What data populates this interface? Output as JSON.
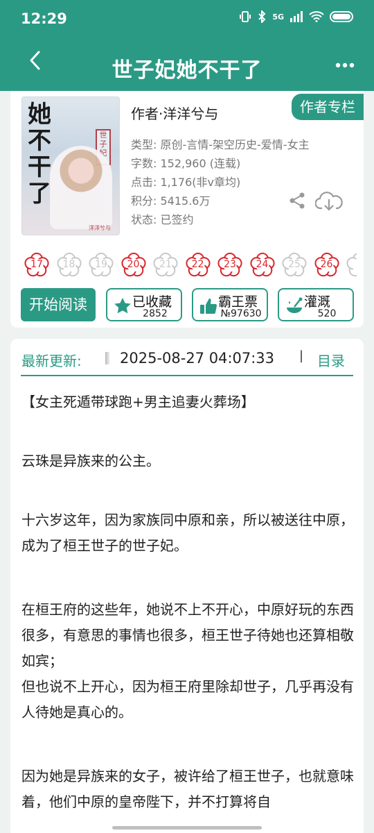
{
  "status_bar": {
    "time": "12:29",
    "network": "5G"
  },
  "nav": {
    "title": "世子妃她不干了"
  },
  "book": {
    "cover": {
      "title_art": "她不干了",
      "tag": "世子妃",
      "author_mark": "洋洋兮与"
    },
    "author": "作者·洋洋兮与",
    "author_column_button": "作者专栏",
    "type": "类型: 原创-言情-架空历史-爱情-女主",
    "words": "字数: 152,960 (连载)",
    "clicks": "点击: 1,176(非v章均)",
    "score": "积分: 5415.6万",
    "status": "状态: 已签约"
  },
  "flowers": [
    {
      "n": "17",
      "active": true
    },
    {
      "n": "18",
      "active": false
    },
    {
      "n": "19",
      "active": false
    },
    {
      "n": "20",
      "active": true
    },
    {
      "n": "21",
      "active": false
    },
    {
      "n": "22",
      "active": true
    },
    {
      "n": "23",
      "active": true
    },
    {
      "n": "24",
      "active": true
    },
    {
      "n": "25",
      "active": false
    },
    {
      "n": "26",
      "active": true
    },
    {
      "n": "",
      "active": false
    }
  ],
  "actions": {
    "start_reading": "开始阅读",
    "favorite": {
      "label": "已收藏",
      "count": "2852"
    },
    "bawang": {
      "label": "霸王票",
      "count": "№97630"
    },
    "guangai": {
      "label": "灌溉",
      "count": "520"
    }
  },
  "colors": {
    "primary": "#2b9a85",
    "flower_red": "#d9252b",
    "flower_grey": "#c8c8c8"
  },
  "update": {
    "label": "最新更新:",
    "date": "2025-08-27 04:07:33",
    "separator": "|",
    "toc": "目录"
  },
  "summary": [
    "【女主死遁带球跑+男主追妻火葬场】",
    "云珠是异族来的公主。",
    "十六岁这年，因为家族同中原和亲，所以被送往中原，成为了桓王世子的世子妃。",
    "在桓王府的这些年，她说不上不开心，中原好玩的东西很多，有意思的事情也很多，桓王世子待她也还算相敬如宾；",
    "但也说不上开心，因为桓王府里除却世子，几乎再没有人待她是真心的。",
    "因为她是异族来的女子，被许给了桓王世子，也就意味着，他们中原的皇帝陛下，并不打算将自"
  ]
}
